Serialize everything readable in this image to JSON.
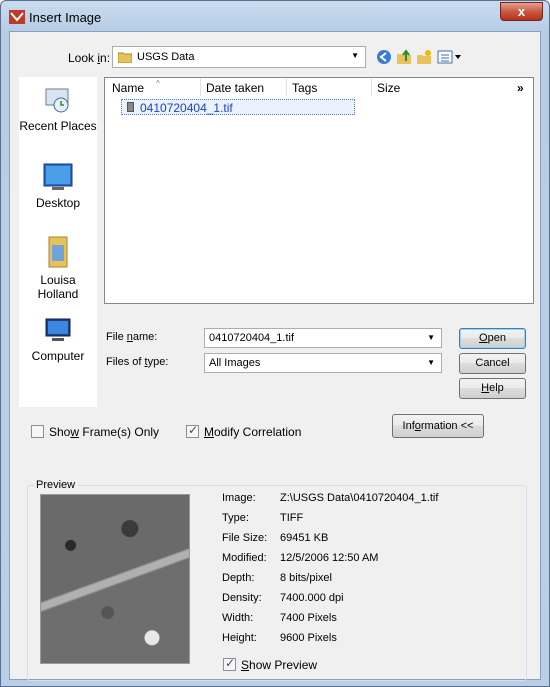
{
  "window": {
    "title": "Insert Image",
    "close_label": "x"
  },
  "lookin": {
    "label": "Look in:",
    "value": "USGS Data"
  },
  "places": [
    {
      "label": "Recent Places"
    },
    {
      "label": "Desktop"
    },
    {
      "label_line1": "Louisa",
      "label_line2": "Holland"
    },
    {
      "label": "Computer"
    }
  ],
  "filelist": {
    "columns": [
      "Name",
      "Date taken",
      "Tags",
      "Size"
    ],
    "more": "»",
    "files": [
      {
        "name": "0410720404_1.tif"
      }
    ]
  },
  "filename": {
    "label": "File name:",
    "value": "0410720404_1.tif"
  },
  "filetype": {
    "label": "Files of type:",
    "value": "All Images"
  },
  "buttons": {
    "open": "Open",
    "cancel": "Cancel",
    "help": "Help",
    "information": "Information <<"
  },
  "options": {
    "show_frames": {
      "label": "Show Frame(s) Only",
      "checked": false
    },
    "modify_correlation": {
      "label": "Modify Correlation",
      "checked": true
    }
  },
  "preview": {
    "title": "Preview",
    "show_preview": {
      "label": "Show Preview",
      "checked": true
    },
    "info": [
      {
        "key": "Image:",
        "value": "Z:\\USGS Data\\0410720404_1.tif"
      },
      {
        "key": "Type:",
        "value": "TIFF"
      },
      {
        "key": "File Size:",
        "value": "69451 KB"
      },
      {
        "key": "Modified:",
        "value": "12/5/2006 12:50 AM"
      },
      {
        "key": "Depth:",
        "value": "8 bits/pixel"
      },
      {
        "key": "Density:",
        "value": "7400.000 dpi"
      },
      {
        "key": "Width:",
        "value": "7400 Pixels"
      },
      {
        "key": "Height:",
        "value": "9600 Pixels"
      }
    ]
  }
}
